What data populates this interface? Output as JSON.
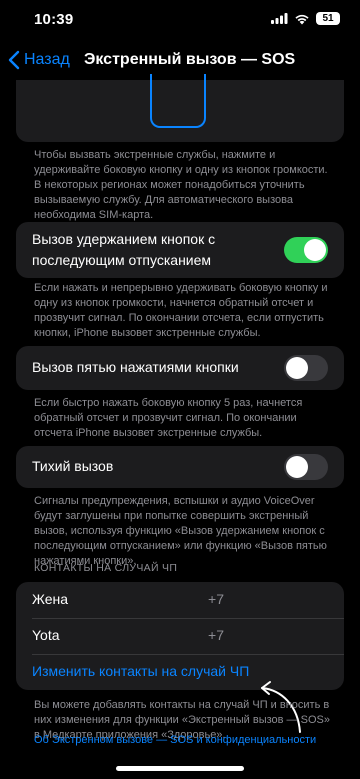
{
  "status_bar": {
    "time": "10:39",
    "battery": "51"
  },
  "nav": {
    "back_label": "Назад",
    "title": "Экстренный вызов — SOS"
  },
  "intro_text": "Чтобы вызвать экстренные службы, нажмите и удерживайте боковую кнопку и одну из кнопок громкости. В некоторых регионах может понадобиться уточнить вызываемую службу. Для автоматического вызова необходима SIM-карта.",
  "settings": [
    {
      "label": "Вызов удержанием кнопок с последующим отпусканием",
      "enabled": true,
      "footnote": "Если нажать и непрерывно удерживать боковую кнопку и одну из кнопок громкости, начнется обратный отсчет и прозвучит сигнал. По окончании отсчета, если отпустить кнопки, iPhone вызовет экстренные службы."
    },
    {
      "label": "Вызов пятью нажатиями кнопки",
      "enabled": false,
      "footnote": "Если быстро нажать боковую кнопку 5 раз, начнется обратный отсчет и прозвучит сигнал. По окончании отсчета iPhone вызовет экстренные службы."
    },
    {
      "label": "Тихий вызов",
      "enabled": false,
      "footnote": "Сигналы предупреждения, вспышки и аудио VoiceOver будут заглушены при попытке совершить экстренный вызов, используя функцию «Вызов удержанием кнопок с последующим отпусканием» или функцию «Вызов пятью нажатиями кнопки»."
    }
  ],
  "contacts": {
    "header": "КОНТАКТЫ НА СЛУЧАЙ ЧП",
    "items": [
      {
        "name": "Жена",
        "number": "+7"
      },
      {
        "name": "Yota",
        "number": "+7"
      }
    ],
    "edit_label": "Изменить контакты на случай ЧП",
    "footnote": "Вы можете добавлять контакты на случай ЧП и вносить в них изменения для функции «Экстренный вызов — SOS» в Медкарте приложения «Здоровье».",
    "privacy_link": "Об Экстренном вызове — SOS и конфиденциальности"
  },
  "colors": {
    "accent": "#0a84ff",
    "toggle_on": "#30d158",
    "card": "#1c1c1e"
  }
}
